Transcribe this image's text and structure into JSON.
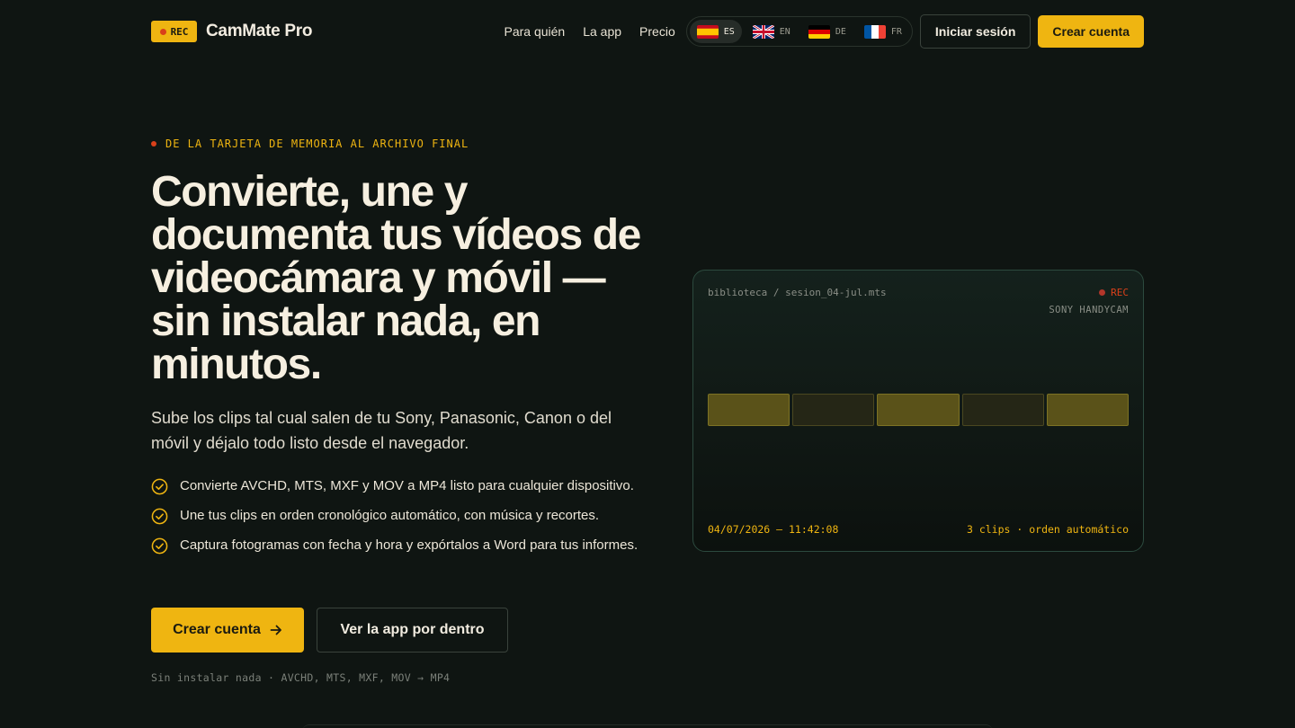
{
  "nav": {
    "badge": "REC",
    "brand": "CamMate Pro",
    "links": [
      "Para quién",
      "La app",
      "Precio"
    ],
    "languages": [
      {
        "code": "ES",
        "active": true
      },
      {
        "code": "EN",
        "active": false
      },
      {
        "code": "DE",
        "active": false
      },
      {
        "code": "FR",
        "active": false
      }
    ],
    "login": "Iniciar sesión",
    "signup": "Crear cuenta"
  },
  "hero": {
    "eyebrow": "DE LA TARJETA DE MEMORIA AL ARCHIVO FINAL",
    "headline": "Convierte, une y documenta tus vídeos de videocámara y móvil — sin instalar nada, en minutos.",
    "subhead": "Sube los clips tal cual salen de tu Sony, Panasonic, Canon o del móvil y déjalo todo listo desde el navegador.",
    "features": [
      "Convierte AVCHD, MTS, MXF y MOV a MP4 listo para cualquier dispositivo.",
      "Une tus clips en orden cronológico automático, con música y recortes.",
      "Captura fotogramas con fecha y hora y expórtalos a Word para tus informes."
    ],
    "cta_primary": "Crear cuenta",
    "cta_secondary": "Ver la app por dentro",
    "footnote": "Sin instalar nada · AVCHD, MTS, MXF, MOV → MP4"
  },
  "preview": {
    "path": "biblioteca / sesion_04-jul.mts",
    "rec": "REC",
    "camera": "SONY HANDYCAM",
    "frames": [
      "on",
      "off",
      "on",
      "off",
      "on"
    ],
    "timestamp": "04/07/2026 — 11:42:08",
    "meta": "3 clips · orden automático"
  },
  "colors": {
    "background": "#0f1512",
    "accent": "#efb511",
    "rec": "#d9401a"
  }
}
